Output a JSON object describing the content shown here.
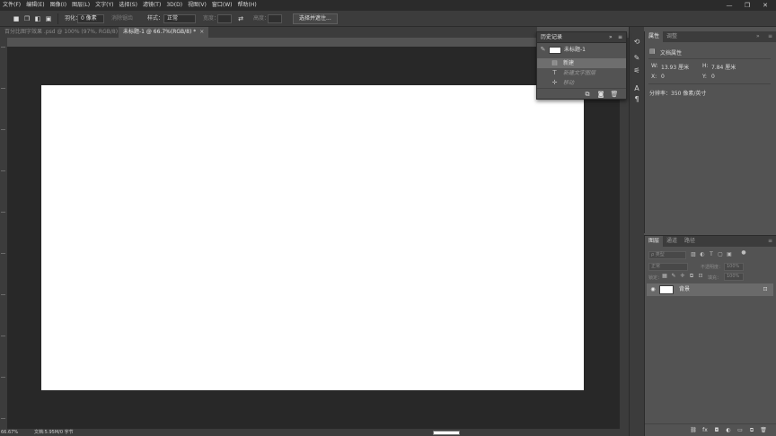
{
  "menubar": {
    "items": [
      "文件(F)",
      "编辑(E)",
      "图像(I)",
      "图层(L)",
      "文字(Y)",
      "选择(S)",
      "滤镜(T)",
      "3D(D)",
      "视图(V)",
      "窗口(W)",
      "帮助(H)"
    ],
    "minimize": "—",
    "restore": "❐",
    "close": "✕"
  },
  "options": {
    "feather_label": "羽化：",
    "feather_value": "0 像素",
    "antialias_label": "消除锯齿",
    "style_label": "样式：",
    "style_value": "正常",
    "width_label": "宽度：",
    "height_label": "高度：",
    "select_mask_button": "选择并遮住..."
  },
  "tabs": [
    {
      "label": "百分比图字效果 .psd @ 100% (97%, RGB/8) *",
      "active": false
    },
    {
      "label": "未标题-1 @ 66.7%(RGB/8) *",
      "active": true
    }
  ],
  "tab_close": "×",
  "history": {
    "title": "历史记录",
    "collapse": "»",
    "menu": "≡",
    "snapshot_name": "未标题-1",
    "steps": [
      {
        "icon": "document-icon",
        "label": "新建",
        "active": true
      },
      {
        "icon": "type-icon",
        "label": "新建文字图层",
        "active": false
      },
      {
        "icon": "move-icon",
        "label": "移动",
        "active": false
      }
    ]
  },
  "properties": {
    "tabs": [
      "属性",
      "调整"
    ],
    "section_title": "文档属性",
    "width_label": "W:",
    "width_value": "13.93 厘米",
    "height_label": "H:",
    "height_value": "7.84 厘米",
    "x_label": "X:",
    "x_value": "0",
    "y_label": "Y:",
    "y_value": "0",
    "resolution": "分辨率：350 像素/英寸"
  },
  "layers": {
    "tabs": [
      "图层",
      "通道",
      "路径"
    ],
    "kind_placeholder": "ρ 类型",
    "blend_mode": "正常",
    "opacity_label": "不透明度：",
    "opacity_value": "100%",
    "lock_label": "锁定：",
    "fill_label": "填充：",
    "fill_value": "100%",
    "layer_name": "背景"
  },
  "status": {
    "zoom": "66.67%",
    "doc_info": "文档:5.95M/0 字节"
  },
  "colors": {
    "menubar": "#2b2b2b",
    "panel": "#535353",
    "panel_dark": "#3c3c3c",
    "pasteboard": "#282828",
    "canvas": "#ffffff"
  }
}
